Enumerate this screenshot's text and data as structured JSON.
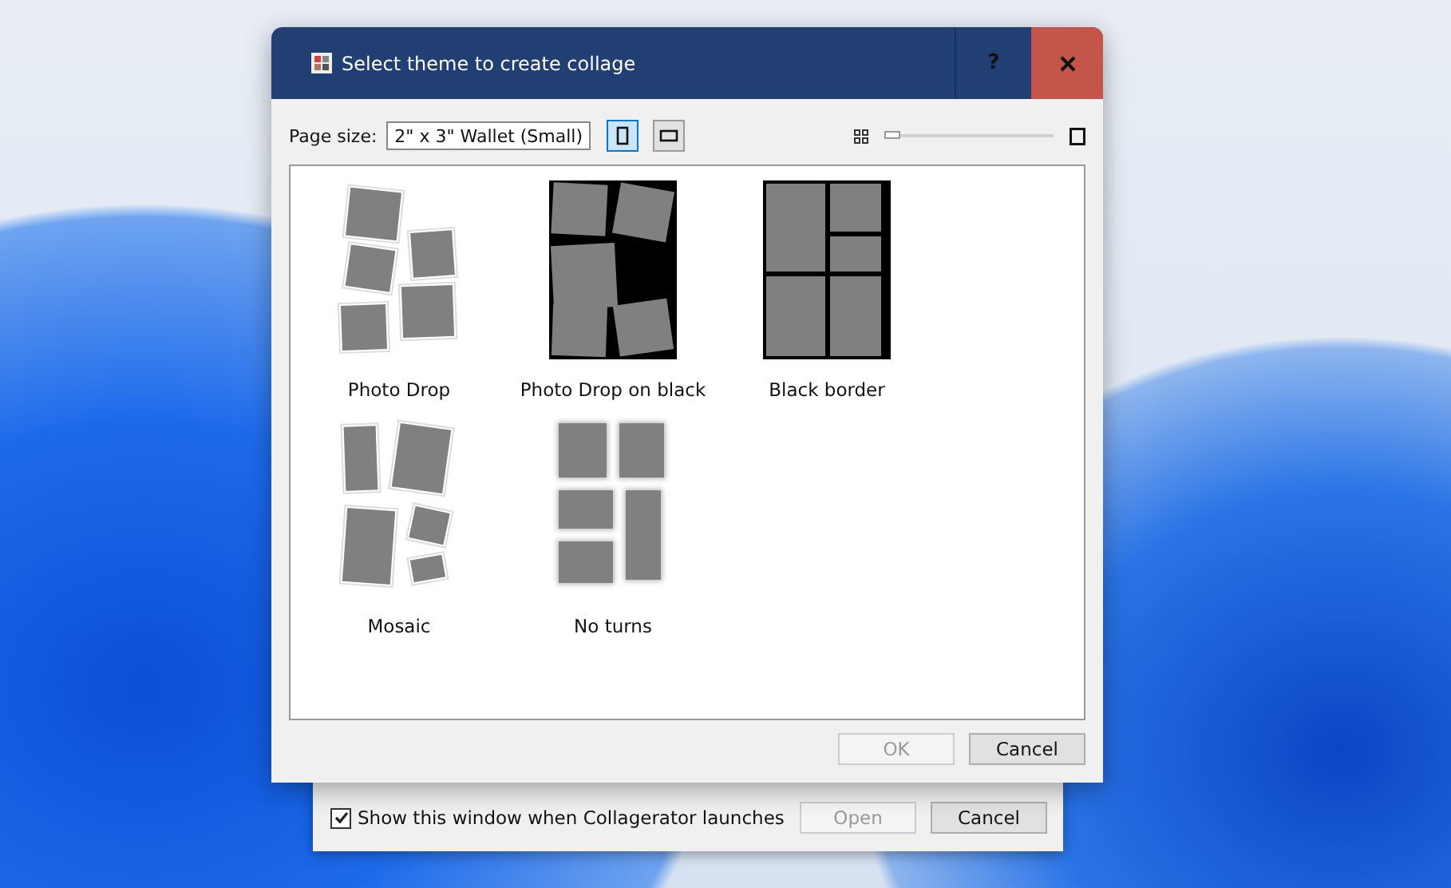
{
  "dialog": {
    "title": "Select theme to create collage",
    "help": "?"
  },
  "toolbar": {
    "page_size_label": "Page size:",
    "page_size": "2\" x 3\" Wallet (Small)",
    "orientations": [
      {
        "kind": "portrait",
        "selected": true
      },
      {
        "kind": "landscape",
        "selected": false
      }
    ],
    "zoom": {
      "level": 0.0
    }
  },
  "themes": [
    {
      "kind": "photo-drop",
      "label": "Photo Drop",
      "selected": false
    },
    {
      "kind": "photo-drop-black",
      "label": "Photo Drop on black",
      "selected": false
    },
    {
      "kind": "black-border",
      "label": "Black border",
      "selected": false
    },
    {
      "kind": "mosaic",
      "label": "Mosaic",
      "selected": false
    },
    {
      "kind": "no-turns",
      "label": "No turns",
      "selected": false
    }
  ],
  "buttons": [
    {
      "label": "OK",
      "disabled": true
    },
    {
      "label": "Cancel",
      "disabled": false
    }
  ],
  "background_window": {
    "checkbox": {
      "label": "Show this window when Collagerator launches",
      "checked": true
    },
    "buttons": [
      {
        "label": "Open",
        "disabled": true
      },
      {
        "label": "Cancel",
        "disabled": false
      }
    ]
  }
}
